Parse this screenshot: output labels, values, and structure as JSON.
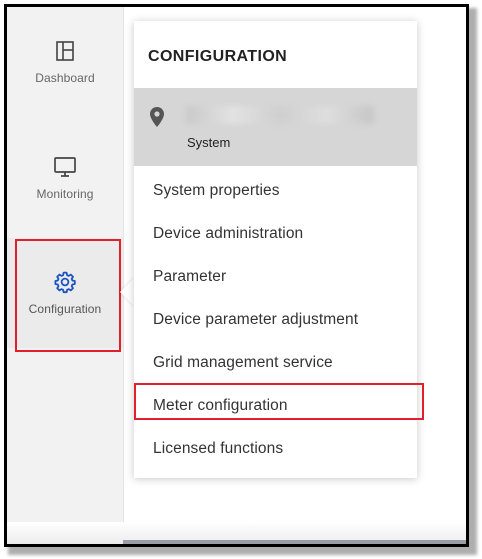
{
  "sidebar": {
    "items": [
      {
        "label": "Dashboard",
        "icon": "dashboard-icon",
        "active": false
      },
      {
        "label": "Monitoring",
        "icon": "monitor-icon",
        "active": false
      },
      {
        "label": "Configuration",
        "icon": "gear-icon",
        "active": true
      }
    ]
  },
  "panel": {
    "title": "CONFIGURATION",
    "system": {
      "name": "",
      "label": "System",
      "icon": "location-pin-icon"
    },
    "menu": [
      {
        "label": "System properties"
      },
      {
        "label": "Device administration"
      },
      {
        "label": "Parameter"
      },
      {
        "label": "Device parameter adjustment"
      },
      {
        "label": "Grid management service"
      },
      {
        "label": "Meter configuration",
        "highlighted": true
      },
      {
        "label": "Licensed functions"
      }
    ]
  },
  "colors": {
    "highlight": "#e0202a",
    "accent": "#1a52c4",
    "system_block": "#d6d6d6",
    "sidebar_bg": "#f2f2f2"
  }
}
